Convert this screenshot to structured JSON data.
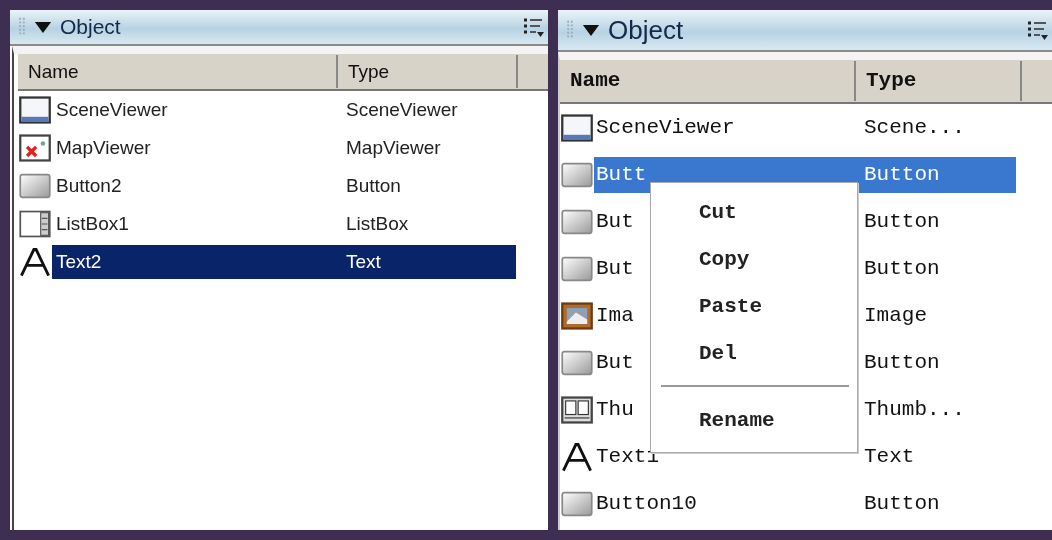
{
  "panels": [
    {
      "kind": "sans",
      "title": "Object",
      "columns": [
        "Name",
        "Type"
      ],
      "rows": [
        {
          "kind": "scene",
          "name": "SceneViewer",
          "type": "SceneViewer",
          "selected": false
        },
        {
          "kind": "map",
          "name": "MapViewer",
          "type": "MapViewer",
          "selected": false
        },
        {
          "kind": "button",
          "name": "Button2",
          "type": "Button",
          "selected": false
        },
        {
          "kind": "listbox",
          "name": "ListBox1",
          "type": "ListBox",
          "selected": false
        },
        {
          "kind": "text",
          "name": "Text2",
          "type": "Text",
          "selected": true
        }
      ]
    },
    {
      "kind": "mono",
      "title": "Object",
      "columns": [
        "Name",
        "Type"
      ],
      "rows": [
        {
          "kind": "scene",
          "name": "SceneViewer",
          "type": "Scene...",
          "selected": false
        },
        {
          "kind": "button",
          "name": "Butt",
          "type": "Button",
          "selected": true
        },
        {
          "kind": "button",
          "name": "But",
          "type": "Button",
          "selected": false
        },
        {
          "kind": "button",
          "name": "But",
          "type": "Button",
          "selected": false
        },
        {
          "kind": "image",
          "name": "Ima",
          "type": "Image",
          "selected": false
        },
        {
          "kind": "button",
          "name": "But",
          "type": "Button",
          "selected": false
        },
        {
          "kind": "thumb",
          "name": "Thu",
          "type": "Thumb...",
          "selected": false
        },
        {
          "kind": "text",
          "name": "Text1",
          "type": "Text",
          "selected": false
        },
        {
          "kind": "button",
          "name": "Button10",
          "type": "Button",
          "selected": false
        }
      ],
      "context_menu": {
        "items": [
          {
            "kind": "item",
            "label": "Cut"
          },
          {
            "kind": "item",
            "label": "Copy"
          },
          {
            "kind": "item",
            "label": "Paste"
          },
          {
            "kind": "item",
            "label": "Del"
          },
          {
            "kind": "separator"
          },
          {
            "kind": "item",
            "label": "Rename"
          }
        ]
      }
    }
  ]
}
